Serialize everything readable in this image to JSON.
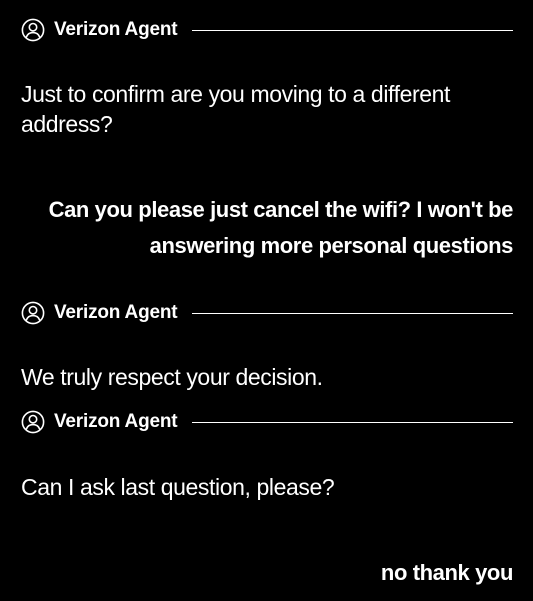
{
  "conversation": {
    "agent_name": "Verizon Agent",
    "messages": [
      {
        "sender": "agent",
        "text": "Just to confirm are you moving to a different address?"
      },
      {
        "sender": "user",
        "text": "Can you please just cancel the wifi? I won't be answering more personal questions"
      },
      {
        "sender": "agent",
        "text": "We truly respect your decision."
      },
      {
        "sender": "agent",
        "text": "Can I ask last question, please?"
      },
      {
        "sender": "user",
        "text": "no thank you"
      }
    ]
  },
  "colors": {
    "background": "#000000",
    "text": "#ffffff"
  },
  "icons": {
    "agent_avatar": "user-circle-icon"
  }
}
